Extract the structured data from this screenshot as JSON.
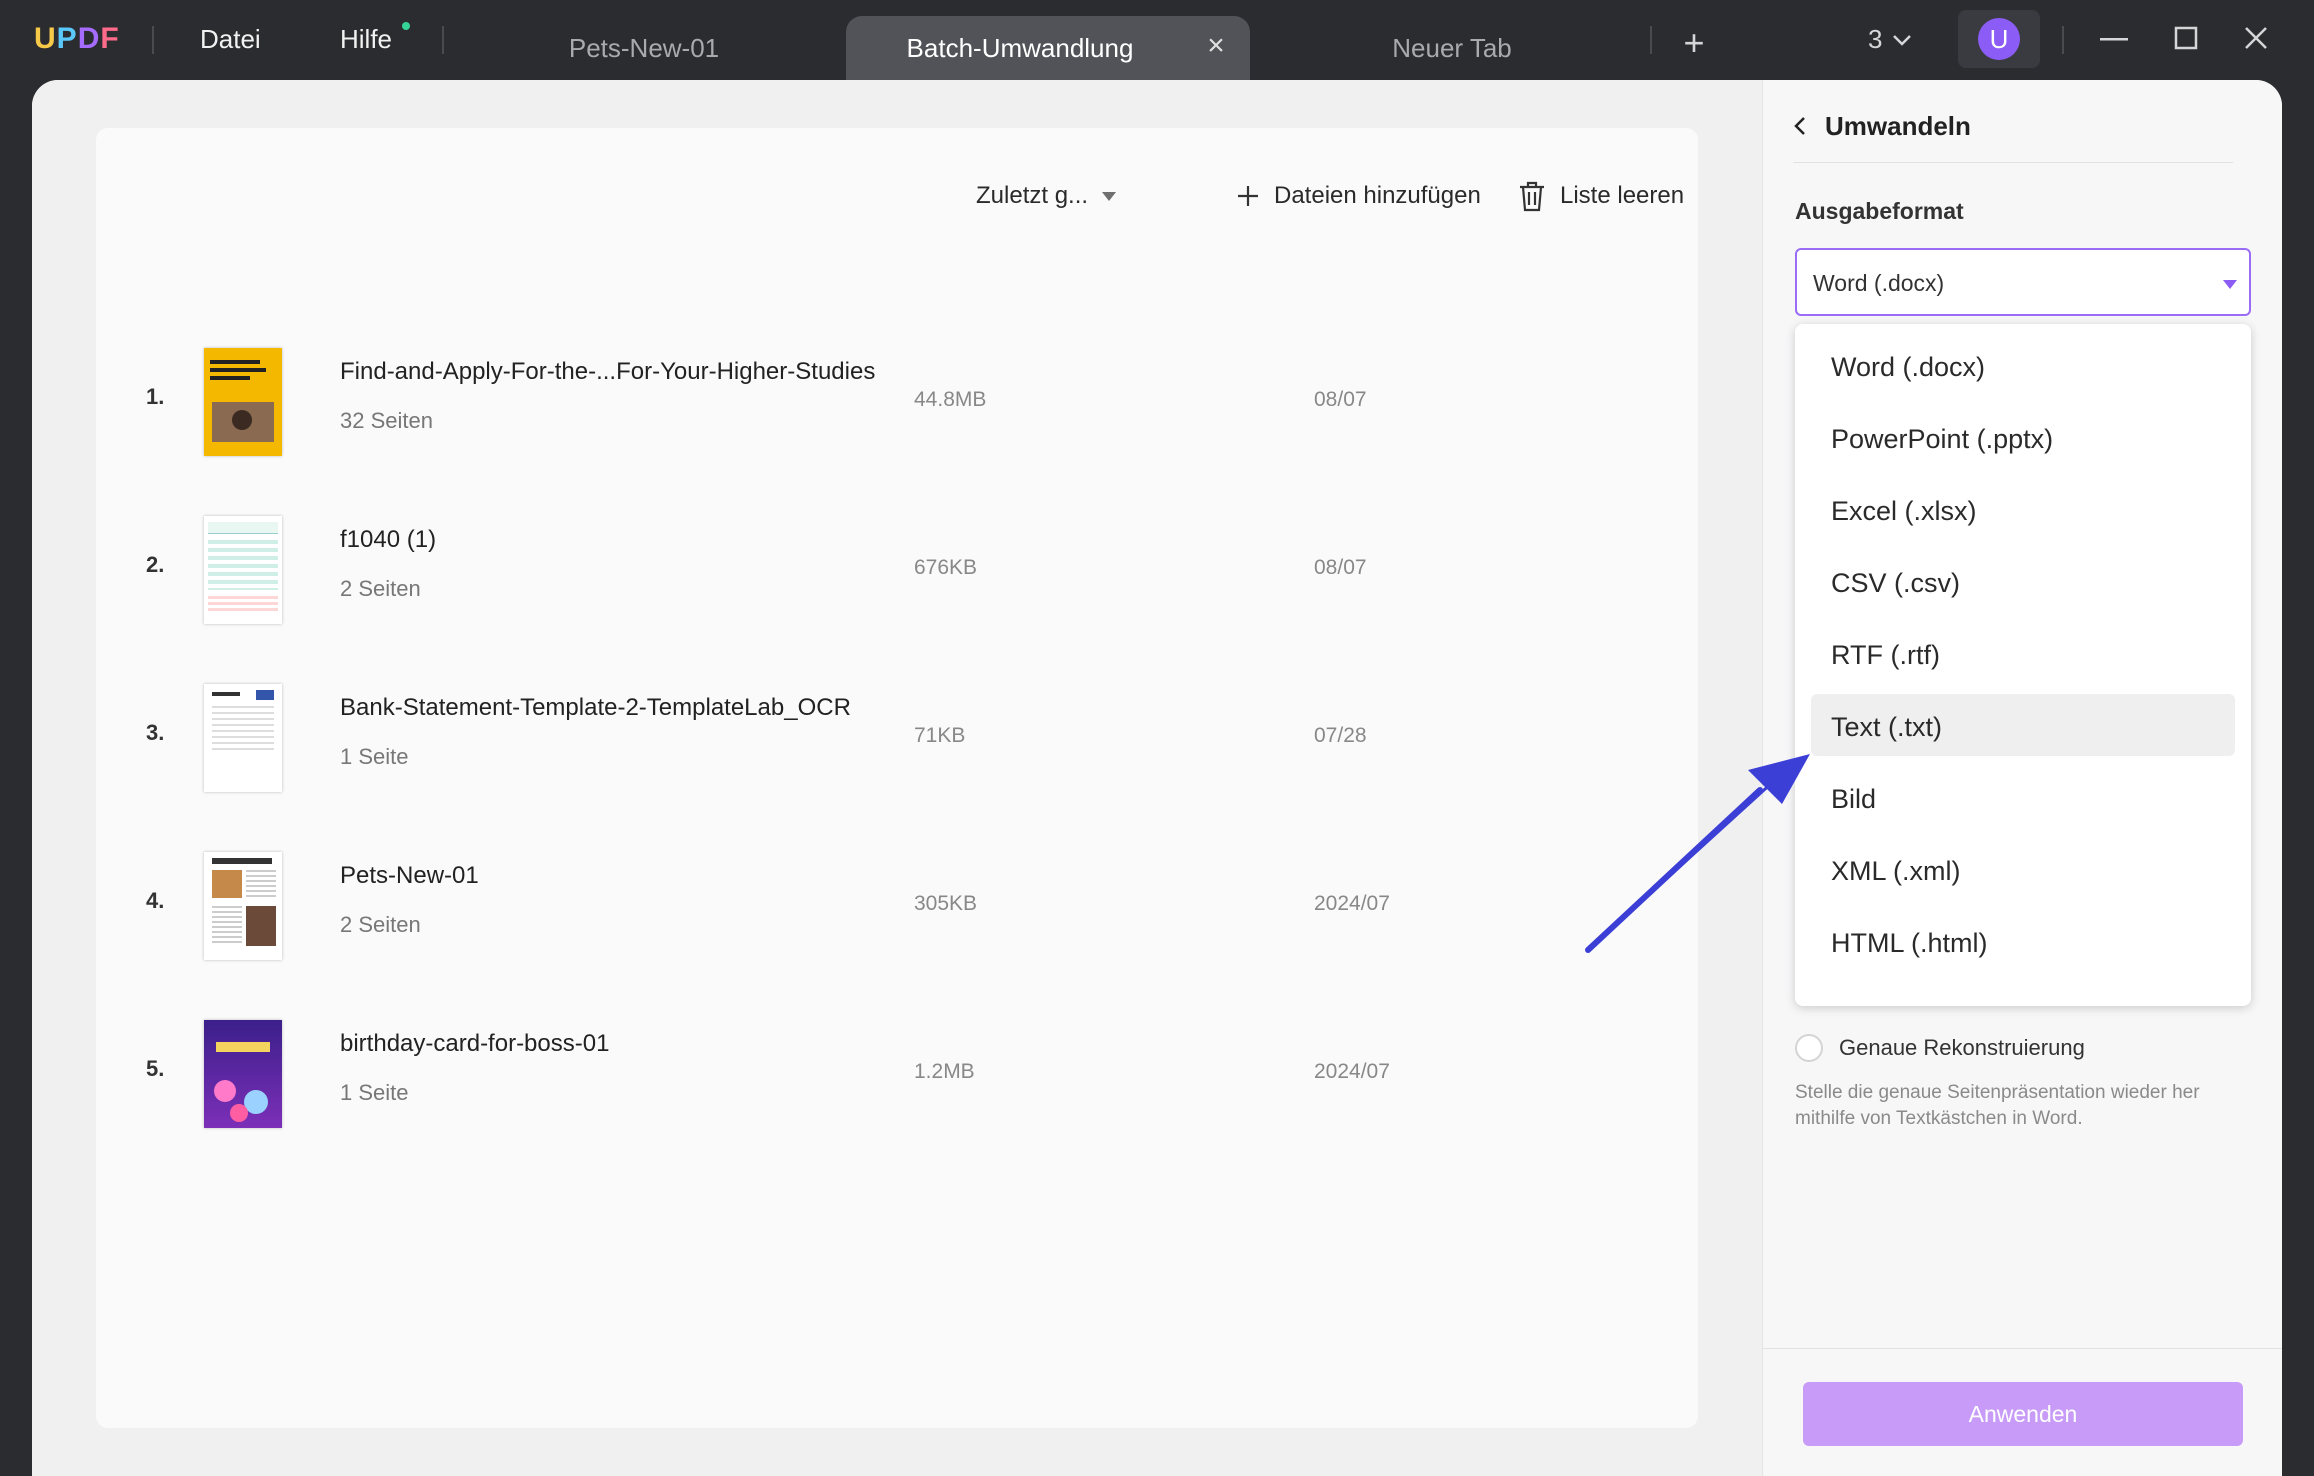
{
  "titlebar": {
    "logo": [
      "U",
      "P",
      "D",
      "F"
    ],
    "menu": {
      "file": "Datei",
      "help": "Hilfe"
    },
    "tabs": [
      {
        "label": "Pets-New-01"
      },
      {
        "label": "Batch-Umwandlung",
        "active": true
      },
      {
        "label": "Neuer Tab"
      }
    ],
    "window_count": "3",
    "avatar_initial": "U",
    "icons": [
      "close-tab-icon",
      "plus-icon",
      "chevron-down-icon",
      "minimize-icon",
      "maximize-icon",
      "close-window-icon"
    ]
  },
  "toolbar": {
    "sort_label": "Zuletzt g...",
    "add_label": "Dateien hinzufügen",
    "clear_label": "Liste leeren"
  },
  "files": [
    {
      "num": "1.",
      "name": "Find-and-Apply-For-the-...For-Your-Higher-Studies",
      "pages": "32 Seiten",
      "size": "44.8MB",
      "date": "08/07"
    },
    {
      "num": "2.",
      "name": "f1040 (1)",
      "pages": "2 Seiten",
      "size": "676KB",
      "date": "08/07"
    },
    {
      "num": "3.",
      "name": "Bank-Statement-Template-2-TemplateLab_OCR",
      "pages": "1 Seite",
      "size": "71KB",
      "date": "07/28"
    },
    {
      "num": "4.",
      "name": "Pets-New-01",
      "pages": "2 Seiten",
      "size": "305KB",
      "date": "2024/07"
    },
    {
      "num": "5.",
      "name": "birthday-card-for-boss-01",
      "pages": "1 Seite",
      "size": "1.2MB",
      "date": "2024/07"
    }
  ],
  "side": {
    "title": "Umwandeln",
    "format_label": "Ausgabeformat",
    "selected_format": "Word (.docx)",
    "options": [
      "Word (.docx)",
      "PowerPoint (.pptx)",
      "Excel (.xlsx)",
      "CSV (.csv)",
      "RTF (.rtf)",
      "Text (.txt)",
      "Bild",
      "XML (.xml)",
      "HTML (.html)"
    ],
    "highlighted_option": "Text (.txt)",
    "reconstruction_label": "Genaue Rekonstruierung",
    "reconstruction_hint": "Stelle die genaue Seitenpräsentation wieder her mithilfe von Textkästchen in Word.",
    "apply_label": "Anwenden"
  },
  "colors": {
    "accent": "#8b5cf6",
    "apply_button": "#c79bf7",
    "arrow": "#3c3fd6"
  }
}
